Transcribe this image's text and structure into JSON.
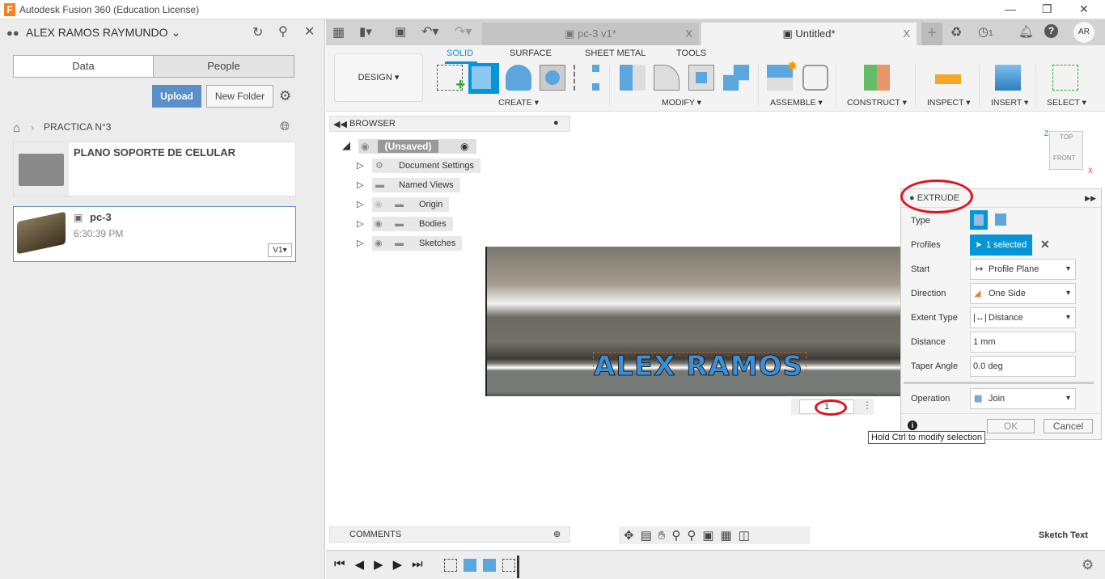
{
  "window": {
    "title": "Autodesk Fusion 360 (Education License)",
    "minimize": "—",
    "maximize": "❐",
    "close": "✕"
  },
  "data_panel": {
    "user": "ALEX RAMOS RAYMUNDO",
    "tabs": [
      "Data",
      "People"
    ],
    "upload": "Upload",
    "new_folder": "New Folder",
    "breadcrumb": "PRACTICA N°3",
    "items": [
      {
        "name": "PLANO SOPORTE DE CELULAR",
        "type": "folder"
      },
      {
        "name": "pc-3",
        "time": "6:30:39 PM",
        "version": "V1"
      }
    ]
  },
  "doc_tabs": [
    {
      "label": "pc-3 v1*",
      "active": false
    },
    {
      "label": "Untitled*",
      "active": true
    }
  ],
  "topbar": {
    "jobs_count": "1",
    "avatar": "AR"
  },
  "toolbar": {
    "workspace": "DESIGN",
    "tabs": [
      "SOLID",
      "SURFACE",
      "SHEET METAL",
      "TOOLS"
    ],
    "active_tab": "SOLID",
    "groups": [
      "CREATE",
      "MODIFY",
      "ASSEMBLE",
      "CONSTRUCT",
      "INSPECT",
      "INSERT",
      "SELECT"
    ]
  },
  "browser": {
    "title": "BROWSER",
    "root": "(Unsaved)",
    "nodes": [
      "Document Settings",
      "Named Views",
      "Origin",
      "Bodies",
      "Sketches"
    ]
  },
  "viewcube": {
    "top": "TOP",
    "front": "FRONT",
    "z": "Z",
    "x": "X"
  },
  "model": {
    "text": "ALEX RAMOS"
  },
  "mini_input": {
    "value": "1"
  },
  "extrude": {
    "title": "EXTRUDE",
    "rows": [
      {
        "label": "Type"
      },
      {
        "label": "Profiles",
        "value": "1 selected"
      },
      {
        "label": "Start",
        "value": "Profile Plane"
      },
      {
        "label": "Direction",
        "value": "One Side"
      },
      {
        "label": "Extent Type",
        "value": "Distance"
      },
      {
        "label": "Distance",
        "value": "1 mm"
      },
      {
        "label": "Taper Angle",
        "value": "0.0 deg"
      },
      {
        "label": "Operation",
        "value": "Join"
      }
    ],
    "ok": "OK",
    "cancel": "Cancel",
    "tooltip": "Hold Ctrl to modify selection"
  },
  "comments": {
    "title": "COMMENTS"
  },
  "status": {
    "mode": "Sketch Text"
  },
  "colors": {
    "accent": "#0696d7",
    "upload": "#5b8fc7",
    "highlight": "#e0141e"
  }
}
